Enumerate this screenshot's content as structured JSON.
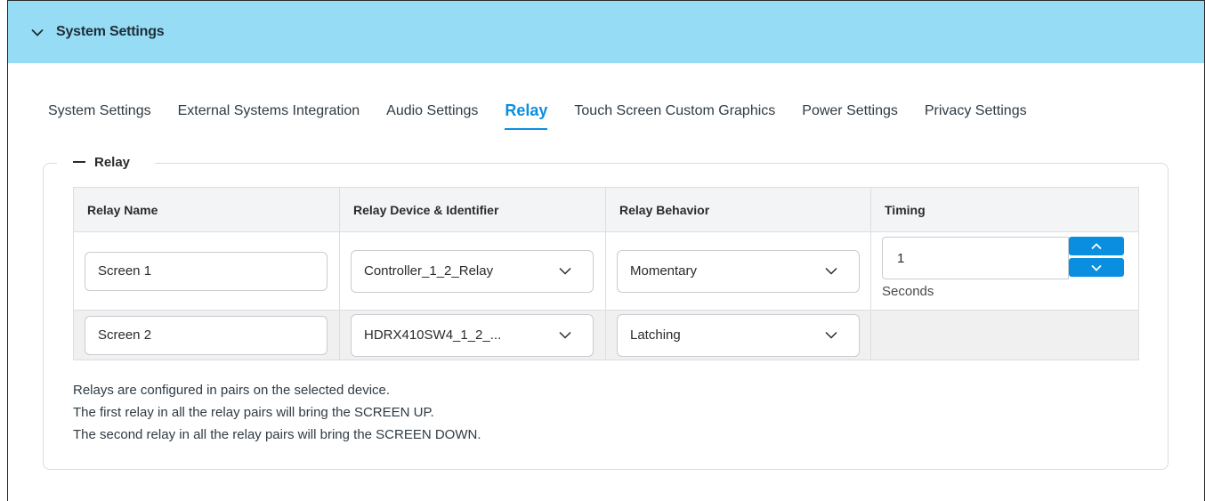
{
  "panel": {
    "title": "System Settings",
    "toggle_icon": "chevron-down-icon"
  },
  "tabs": [
    {
      "label": "System Settings",
      "active": false
    },
    {
      "label": "External Systems Integration",
      "active": false
    },
    {
      "label": "Audio Settings",
      "active": false
    },
    {
      "label": "Relay",
      "active": true
    },
    {
      "label": "Touch Screen Custom Graphics",
      "active": false
    },
    {
      "label": "Power Settings",
      "active": false
    },
    {
      "label": "Privacy Settings",
      "active": false
    }
  ],
  "section": {
    "title": "Relay",
    "collapse_icon": "minus-icon"
  },
  "table": {
    "headers": [
      "Relay Name",
      "Relay Device & Identifier",
      "Relay Behavior",
      "Timing"
    ],
    "rows": [
      {
        "name": "Screen 1",
        "device": "Controller_1_2_Relay",
        "behavior": "Momentary",
        "timing_value": "1",
        "timing_unit": "Seconds"
      },
      {
        "name": "Screen 2",
        "device": "HDRX410SW4_1_2_...",
        "behavior": "Latching"
      }
    ]
  },
  "notes": [
    "Relays are configured in pairs on the selected device.",
    "The first relay in all the relay pairs will bring the SCREEN UP.",
    "The second relay in all the relay pairs will bring the SCREEN DOWN."
  ],
  "colors": {
    "header_bg": "#96dcf4",
    "accent": "#0a8fe0",
    "table_header_bg": "#f3f4f6",
    "row_alt_bg": "#f0f0f0"
  }
}
